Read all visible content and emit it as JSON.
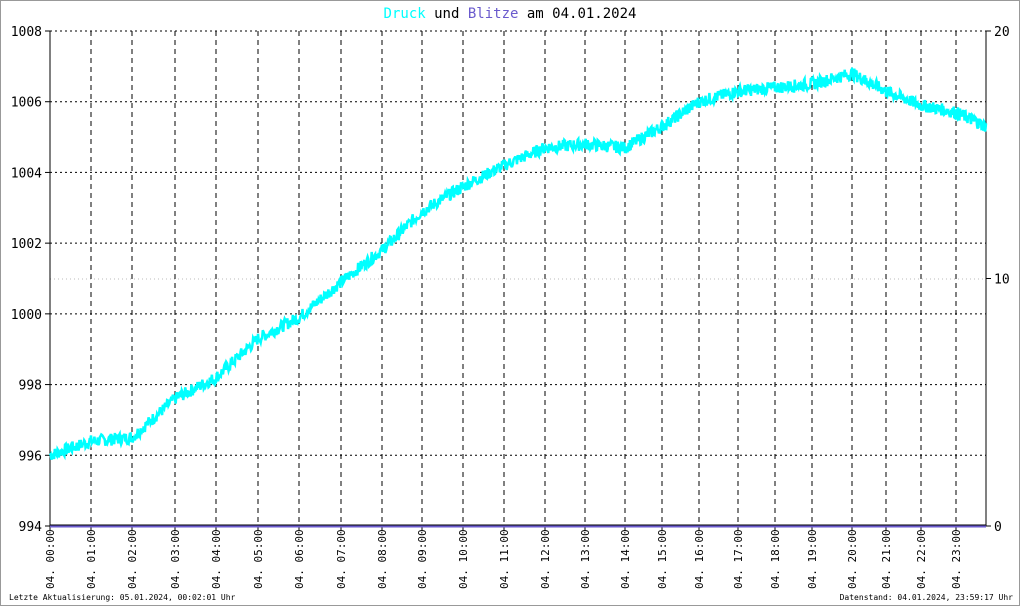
{
  "title": {
    "part1": "Druck",
    "part2": "und",
    "part3": "Blitze",
    "part4": "am 04.01.2024"
  },
  "colors": {
    "druck": "#00ffff",
    "blitze": "#6a5acd",
    "axis": "#000000"
  },
  "footer": {
    "left": "Letzte Aktualisierung: 05.01.2024, 00:02:01 Uhr",
    "right": "Datenstand: 04.01.2024, 23:59:17 Uhr"
  },
  "chart_data": {
    "type": "line",
    "title": "Druck und Blitze am 04.01.2024",
    "ylim": [
      994,
      1008
    ],
    "y2lim": [
      0,
      20
    ],
    "yticks": [
      "994",
      "996",
      "998",
      "1000",
      "1002",
      "1004",
      "1006",
      "1008"
    ],
    "y2ticks": [
      "0",
      "10",
      "20"
    ],
    "xticks": [
      "04. 00:00",
      "04. 01:00",
      "04. 02:00",
      "04. 03:00",
      "04. 04:00",
      "04. 05:00",
      "04. 06:00",
      "04. 07:00",
      "04. 08:00",
      "04. 09:00",
      "04. 10:00",
      "04. 11:00",
      "04. 12:00",
      "04. 13:00",
      "04. 14:00",
      "04. 15:00",
      "04. 16:00",
      "04. 17:00",
      "04. 18:00",
      "04. 19:00",
      "04. 20:00",
      "04. 21:00",
      "04. 22:00",
      "04. 23:00"
    ],
    "series": [
      {
        "name": "Druck",
        "x_hours": [
          0,
          1,
          2,
          3,
          4,
          5,
          6,
          7,
          8,
          9,
          10,
          11,
          12,
          13,
          14,
          15,
          16,
          17,
          18,
          19,
          20,
          21,
          22,
          23,
          24
        ],
        "values": [
          996.0,
          996.4,
          996.5,
          997.6,
          998.2,
          999.3,
          999.9,
          1000.9,
          1001.8,
          1002.9,
          1003.6,
          1004.2,
          1004.7,
          1004.8,
          1004.7,
          1005.3,
          1006.0,
          1006.3,
          1006.4,
          1006.5,
          1006.8,
          1006.3,
          1005.9,
          1005.7,
          1005.3
        ]
      },
      {
        "name": "Blitze",
        "values": [
          0
        ]
      }
    ],
    "grid": true
  }
}
